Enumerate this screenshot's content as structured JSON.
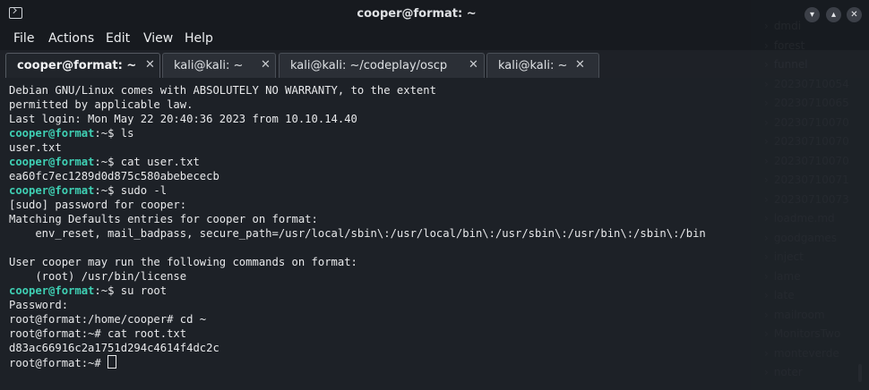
{
  "window": {
    "title": "cooper@format: ~"
  },
  "menu": {
    "items": [
      "File",
      "Actions",
      "Edit",
      "View",
      "Help"
    ]
  },
  "tabs": [
    {
      "label": "cooper@format: ~",
      "active": true
    },
    {
      "label": "kali@kali: ~",
      "active": false
    },
    {
      "label": "kali@kali: ~/codeplay/oscp",
      "active": false
    },
    {
      "label": "kali@kali: ~",
      "active": false
    }
  ],
  "terminal": {
    "lines": [
      {
        "text": "Debian GNU/Linux comes with ABSOLUTELY NO WARRANTY, to the extent"
      },
      {
        "text": "permitted by applicable law."
      },
      {
        "text": "Last login: Mon May 22 20:40:36 2023 from 10.10.14.40"
      },
      {
        "prompt": "cooper@format",
        "path": ":~$ ",
        "cmd": "ls"
      },
      {
        "text": "user.txt"
      },
      {
        "prompt": "cooper@format",
        "path": ":~$ ",
        "cmd": "cat user.txt"
      },
      {
        "text": "ea60fc7ec1289d0d875c580abebececb"
      },
      {
        "prompt": "cooper@format",
        "path": ":~$ ",
        "cmd": "sudo -l"
      },
      {
        "text": "[sudo] password for cooper:"
      },
      {
        "text": "Matching Defaults entries for cooper on format:"
      },
      {
        "text": "    env_reset, mail_badpass, secure_path=/usr/local/sbin\\:/usr/local/bin\\:/usr/sbin\\:/usr/bin\\:/sbin\\:/bin"
      },
      {
        "text": ""
      },
      {
        "text": "User cooper may run the following commands on format:"
      },
      {
        "text": "    (root) /usr/bin/license"
      },
      {
        "prompt": "cooper@format",
        "path": ":~$ ",
        "cmd": "su root"
      },
      {
        "text": "Password:"
      },
      {
        "text": "root@format:/home/cooper# cd ~"
      },
      {
        "text": "root@format:~# cat root.txt"
      },
      {
        "text": "d83ac66916c2a1751d294c4614f4dc2c"
      },
      {
        "text": "root@format:~# ",
        "cursor": true
      }
    ]
  },
  "background_panel": {
    "items": [
      "dmdi",
      "forest",
      "funnel",
      "20230710054",
      "20230710065",
      "20230710070",
      "20230710070",
      "20230710070",
      "20230710071",
      "20230710073",
      "loadme.md",
      "goodgames",
      "inject",
      "lame",
      "late",
      "mailroom",
      "MonitorsTwo",
      "monteverde",
      "noter"
    ]
  }
}
